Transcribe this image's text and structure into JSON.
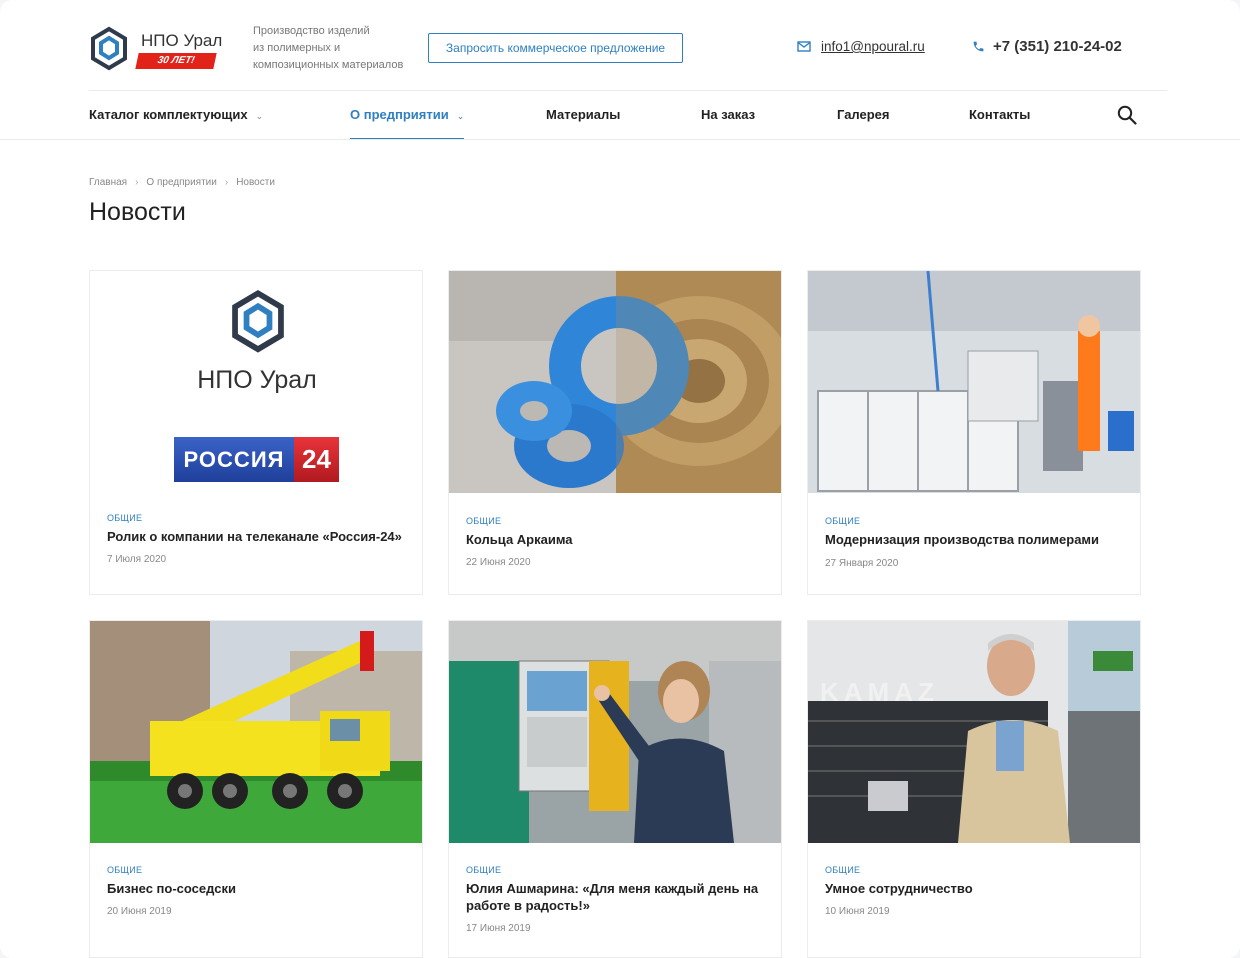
{
  "header": {
    "logo_title": "НПО Урал",
    "logo_badge": "30 ЛЕТ!",
    "tagline": [
      "Производство изделий",
      "из полимерных и",
      "композиционных материалов"
    ],
    "cta_label": "Запросить коммерческое предложение",
    "email": "info1@npoural.ru",
    "phone": "+7 (351) 210-24-02",
    "accent_color": "#2f7fc1",
    "badge_color": "#e2231a"
  },
  "nav": {
    "items": [
      {
        "label": "Каталог комплектующих",
        "has_dropdown": true,
        "active": false
      },
      {
        "label": "О предприятии",
        "has_dropdown": true,
        "active": true
      },
      {
        "label": "Материалы",
        "has_dropdown": false,
        "active": false
      },
      {
        "label": "На заказ",
        "has_dropdown": false,
        "active": false
      },
      {
        "label": "Галерея",
        "has_dropdown": false,
        "active": false
      },
      {
        "label": "Контакты",
        "has_dropdown": false,
        "active": false
      }
    ],
    "search_icon": "search-icon"
  },
  "breadcrumb": [
    "Главная",
    "О предприятии",
    "Новости"
  ],
  "page_title": "Новости",
  "news": [
    {
      "category": "ОБЩИЕ",
      "title": "Ролик о компании на телеканале «Россия-24»",
      "date": "7 Июля 2020",
      "logo_text": "НПО Урал",
      "tv_text_a": "РОССИЯ",
      "tv_text_b": "24"
    },
    {
      "category": "ОБЩИЕ",
      "title": "Кольца Аркаима",
      "date": "22 Июня 2020"
    },
    {
      "category": "ОБЩИЕ",
      "title": "Модернизация производства полимерами",
      "date": "27 Января 2020"
    },
    {
      "category": "ОБЩИЕ",
      "title": "Бизнес по-соседски",
      "date": "20 Июня 2019"
    },
    {
      "category": "ОБЩИЕ",
      "title": "Юлия Ашмарина: «Для меня каждый день на работе в радость!»",
      "date": "17 Июня 2019"
    },
    {
      "category": "ОБЩИЕ",
      "title": "Умное сотрудничество",
      "date": "10 Июня 2019",
      "truck_text": "KAMAZ"
    }
  ]
}
